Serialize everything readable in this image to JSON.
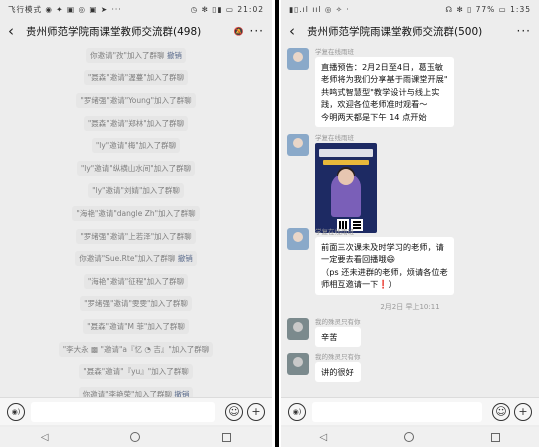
{
  "left": {
    "status": {
      "left": "飞行模式 ◉ ✦ ▣ ◎ ▣ ➤ ···",
      "right": "◷ ✻ ▯▮ ▭ 21:02"
    },
    "title": "贵州师范学院雨课堂教师交流群(498)",
    "mute_icon": "mute-icon",
    "system_messages": [
      {
        "parts": [
          {
            "t": "你邀请",
            "h": false
          },
          {
            "t": "\"孜\"",
            "h": false
          },
          {
            "t": "加入了群聊 ",
            "h": false
          },
          {
            "t": "撤销",
            "h": true
          }
        ]
      },
      {
        "parts": [
          {
            "t": "\"聂森\"邀请\"渥蔓\"加入了群聊",
            "h": false
          }
        ]
      },
      {
        "parts": [
          {
            "t": "\"罗绪强\"邀请\"Young\"加入了群聊",
            "h": false
          }
        ]
      },
      {
        "parts": [
          {
            "t": "\"聂森\"邀请\"郑林\"加入了群聊",
            "h": false
          }
        ]
      },
      {
        "parts": [
          {
            "t": "\"ly\"邀请\"梅\"加入了群聊",
            "h": false
          }
        ]
      },
      {
        "parts": [
          {
            "t": "\"ly\"邀请\"纵横山水间\"加入了群聊",
            "h": false
          }
        ]
      },
      {
        "parts": [
          {
            "t": "\"ly\"邀请\"刘婧\"加入了群聊",
            "h": false
          }
        ]
      },
      {
        "parts": [
          {
            "t": "\"海艳\"邀请\"dangle  Zh\"加入了群聊",
            "h": false
          }
        ]
      },
      {
        "parts": [
          {
            "t": "\"罗绪强\"邀请\"上若泽\"加入了群聊",
            "h": false
          }
        ]
      },
      {
        "parts": [
          {
            "t": "你邀请\"Sue.Rte\"加入了群聊 ",
            "h": false
          },
          {
            "t": "撤销",
            "h": true
          }
        ]
      },
      {
        "parts": [
          {
            "t": "\"海艳\"邀请\"征程\"加入了群聊",
            "h": false
          }
        ]
      },
      {
        "parts": [
          {
            "t": "\"罗绪强\"邀请\"雯雯\"加入了群聊",
            "h": false
          }
        ]
      },
      {
        "parts": [
          {
            "t": "\"聂森\"邀请\"M 菲\"加入了群聊",
            "h": false
          }
        ]
      },
      {
        "parts": [
          {
            "t": "\"李大永 ▩ \"邀请\"a『忆 ◔ 吉』\"加入了群聊",
            "h": false
          }
        ]
      },
      {
        "parts": [
          {
            "t": "\"聂森\"邀请\"『yu』\"加入了群聊",
            "h": false
          }
        ]
      },
      {
        "parts": [
          {
            "t": "你邀请\"李艳荣\"加入了群聊 ",
            "h": false
          },
          {
            "t": "撤销",
            "h": true
          }
        ]
      }
    ]
  },
  "right": {
    "status": {
      "left": "▮▯.ıl ııl ◎ ✧ ·",
      "right": "☊ ✻ ▯ 77% ▭ 1:35"
    },
    "title": "贵州师范学院雨课堂教师交流群(500)",
    "messages": {
      "m1": {
        "sender": "学复在线雨班",
        "lines": [
          "直播预告：2月2日至4日，葛玉敏",
          "老师将为我们分享基于雨课堂开展\"",
          "共鸣式智慧型\"教学设计与线上实",
          "践，欢迎各位老师准时观看～",
          "今明两天都是下午 14 点开始"
        ]
      },
      "m2": {
        "sender": "学复在线雨班"
      },
      "m3": {
        "sender": "学复在线雨班",
        "lines": [
          "前面三次课未及时学习的老师，请",
          "一定要去看回播哦😄",
          "（ps  还未进群的老师，烦请各位老",
          "师相互邀请一下❗）"
        ]
      },
      "timestamp": "2月2日 早上10:11",
      "m4": {
        "sender": "我的殊灵只有你",
        "text": "辛苦"
      },
      "m5": {
        "sender": "我的殊灵只有你",
        "text": "讲的很好"
      }
    }
  },
  "common": {
    "more": "···",
    "back": "‹",
    "voice_icon": "voice-icon",
    "emoji_icon": "emoji-icon",
    "plus_icon": "plus-icon"
  }
}
